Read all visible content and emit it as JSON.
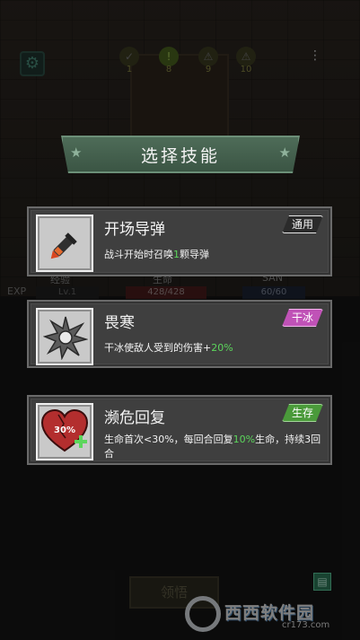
{
  "background": {
    "stages": [
      {
        "num": "1",
        "mark": "✓"
      },
      {
        "num": "8",
        "mark": "!"
      },
      {
        "num": "9",
        "mark": "⚠"
      },
      {
        "num": "10",
        "mark": "⚠"
      }
    ],
    "labels": {
      "weapon": "经验",
      "hp": "生命",
      "san": "SAN"
    },
    "exp_tag": "EXP",
    "level": "Lv.1",
    "hp": "428/428",
    "san": "60/60",
    "claim_label": "领悟"
  },
  "modal": {
    "title": "选择技能",
    "skills": [
      {
        "name": "开场导弹",
        "tag": "通用",
        "tag_type": "general",
        "desc_parts": [
          "战斗开始时召唤",
          "1",
          "颗导弹"
        ]
      },
      {
        "name": "畏寒",
        "tag": "干冰",
        "tag_type": "dry",
        "desc_parts": [
          "干冰使敌人受到的伤害+",
          "20%",
          ""
        ]
      },
      {
        "name": "濒危回复",
        "tag": "生存",
        "tag_type": "survive",
        "badge": "30%",
        "desc_parts": [
          "生命首次<30%，每回合回复",
          "10%",
          "生命，持续3回合"
        ]
      }
    ]
  },
  "watermark": {
    "text": "西西软件园",
    "url": "cr173.com"
  },
  "colors": {
    "banner": "#4e6c58",
    "highlight": "#5cd65c",
    "dry_tag": "#c052b7",
    "survive_tag": "#4a9a3a"
  }
}
